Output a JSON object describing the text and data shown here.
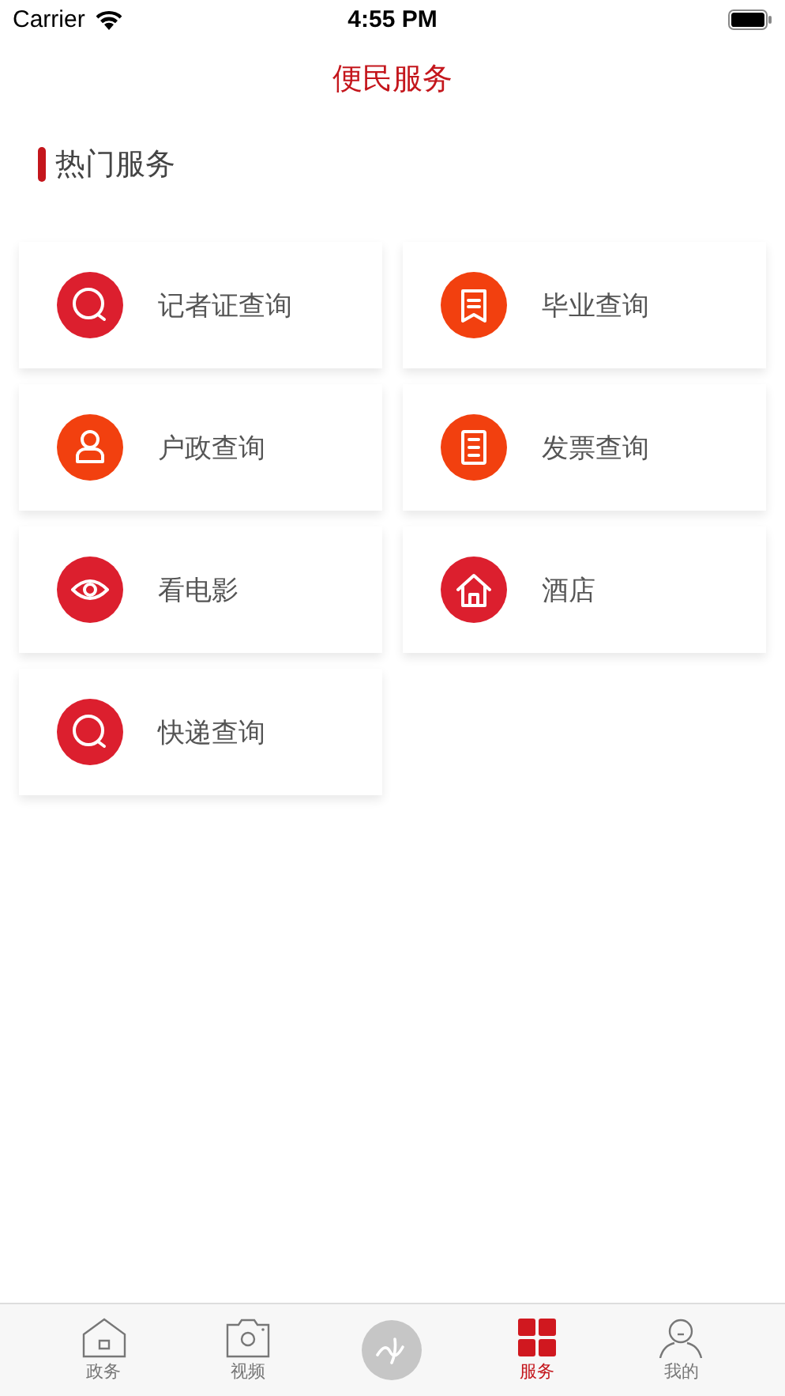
{
  "status_bar": {
    "carrier": "Carrier",
    "time": "4:55 PM"
  },
  "title": "便民服务",
  "section": {
    "title": "热门服务"
  },
  "services": [
    {
      "label": "记者证查询",
      "kind": "search",
      "color": "#dc1f2e"
    },
    {
      "label": "毕业查询",
      "kind": "bookmark",
      "color": "#f2400f"
    },
    {
      "label": "户政查询",
      "kind": "person",
      "color": "#f2400f"
    },
    {
      "label": "发票查询",
      "kind": "document",
      "color": "#f2400f"
    },
    {
      "label": "看电影",
      "kind": "eye",
      "color": "#dc1f2e"
    },
    {
      "label": "酒店",
      "kind": "house",
      "color": "#dc1f2e"
    },
    {
      "label": "快递查询",
      "kind": "search",
      "color": "#dc1f2e"
    }
  ],
  "tabs": [
    {
      "label": "政务",
      "kind": "house",
      "selected": false
    },
    {
      "label": "视频",
      "kind": "camera",
      "selected": false
    },
    {
      "kind": "logo",
      "selected": false
    },
    {
      "label": "服务",
      "kind": "grid",
      "selected": true
    },
    {
      "label": "我的",
      "kind": "person",
      "selected": false
    }
  ]
}
